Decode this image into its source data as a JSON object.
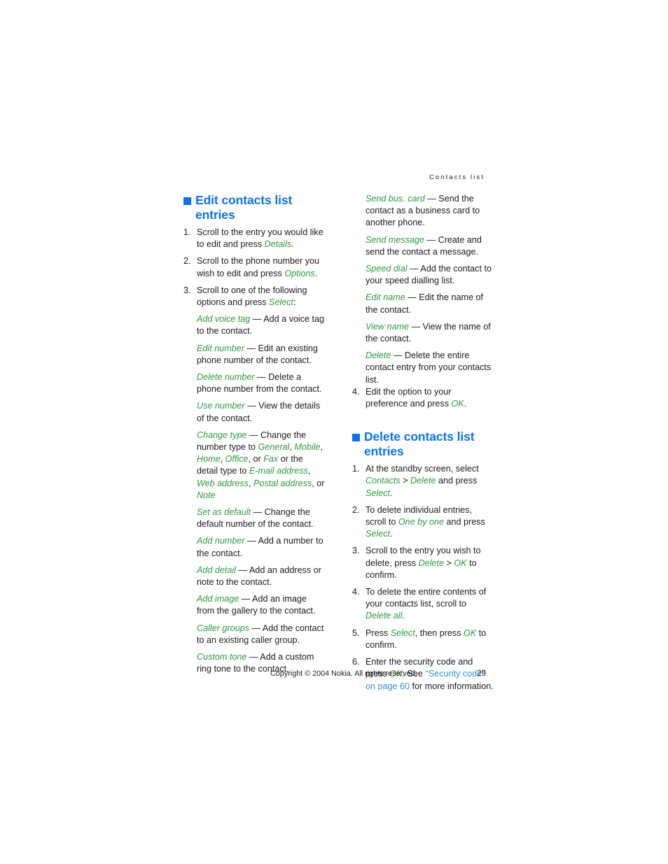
{
  "document": {
    "running_header": "Contacts list",
    "page_number": "29",
    "copyright": "Copyright © 2004 Nokia. All rights reserved.",
    "colors": {
      "heading_blue": "#0b72ec",
      "ui_green": "#2f9a3e",
      "link_blue": "#3b8fdd",
      "body_black": "#1a1a1a",
      "background": "#ffffff"
    }
  },
  "left_column": {
    "heading": "Edit contacts list entries",
    "steps": [
      {
        "number": "1.",
        "parts": [
          {
            "t": "Scroll to the entry you would like to edit and press ",
            "s": "body"
          },
          {
            "t": "Details",
            "s": "ui"
          },
          {
            "t": ".",
            "s": "body"
          }
        ]
      },
      {
        "number": "2.",
        "parts": [
          {
            "t": "Scroll to the phone number you wish to edit and press ",
            "s": "body"
          },
          {
            "t": "Options",
            "s": "ui"
          },
          {
            "t": ".",
            "s": "body"
          }
        ]
      },
      {
        "number": "3.",
        "parts": [
          {
            "t": "Scroll to one of the following options and press ",
            "s": "body"
          },
          {
            "t": "Select",
            "s": "ui"
          },
          {
            "t": ":",
            "s": "body"
          }
        ]
      }
    ],
    "options": [
      {
        "parts": [
          {
            "t": "Add voice tag",
            "s": "ui"
          },
          {
            "t": " — Add a voice tag to the contact.",
            "s": "body"
          }
        ]
      },
      {
        "parts": [
          {
            "t": "Edit number",
            "s": "ui"
          },
          {
            "t": " — Edit an existing phone number of the contact.",
            "s": "body"
          }
        ]
      },
      {
        "parts": [
          {
            "t": "Delete number",
            "s": "ui"
          },
          {
            "t": " — Delete a phone number from the contact.",
            "s": "body"
          }
        ]
      },
      {
        "parts": [
          {
            "t": "Use number",
            "s": "ui"
          },
          {
            "t": " — View the details of the contact.",
            "s": "body"
          }
        ]
      },
      {
        "parts": [
          {
            "t": "Change type",
            "s": "ui"
          },
          {
            "t": " — Change the number type to ",
            "s": "body"
          },
          {
            "t": "General",
            "s": "ui"
          },
          {
            "t": ", ",
            "s": "body"
          },
          {
            "t": "Mobile",
            "s": "ui"
          },
          {
            "t": ", ",
            "s": "body"
          },
          {
            "t": "Home",
            "s": "ui"
          },
          {
            "t": ", ",
            "s": "body"
          },
          {
            "t": "Office",
            "s": "ui"
          },
          {
            "t": ", or ",
            "s": "body"
          },
          {
            "t": "Fax",
            "s": "ui"
          },
          {
            "t": " or the detail type to ",
            "s": "body"
          },
          {
            "t": "E-mail address",
            "s": "ui"
          },
          {
            "t": ", ",
            "s": "body"
          },
          {
            "t": "Web address",
            "s": "ui"
          },
          {
            "t": ", ",
            "s": "body"
          },
          {
            "t": "Postal address",
            "s": "ui"
          },
          {
            "t": ", or ",
            "s": "body"
          },
          {
            "t": "Note",
            "s": "ui"
          }
        ]
      },
      {
        "parts": [
          {
            "t": "Set as default",
            "s": "ui"
          },
          {
            "t": " — Change the default number of the contact.",
            "s": "body"
          }
        ]
      },
      {
        "parts": [
          {
            "t": "Add number",
            "s": "ui"
          },
          {
            "t": " — Add a number to the contact.",
            "s": "body"
          }
        ]
      },
      {
        "parts": [
          {
            "t": "Add detail",
            "s": "ui"
          },
          {
            "t": " — Add an address or note to the contact.",
            "s": "body"
          }
        ]
      },
      {
        "parts": [
          {
            "t": "Add image",
            "s": "ui"
          },
          {
            "t": " — Add an image from the gallery to the contact.",
            "s": "body"
          }
        ]
      },
      {
        "parts": [
          {
            "t": "Caller groups",
            "s": "ui"
          },
          {
            "t": " — Add the contact to an existing caller group.",
            "s": "body"
          }
        ]
      },
      {
        "parts": [
          {
            "t": "Custom tone",
            "s": "ui"
          },
          {
            "t": " — Add a custom ring tone to the contact.",
            "s": "body"
          }
        ]
      }
    ]
  },
  "right_column": {
    "options": [
      {
        "parts": [
          {
            "t": "Send bus. card",
            "s": "ui"
          },
          {
            "t": " — Send the contact as a business card to another phone.",
            "s": "body"
          }
        ]
      },
      {
        "parts": [
          {
            "t": "Send message",
            "s": "ui"
          },
          {
            "t": " — Create and send the contact a message.",
            "s": "body"
          }
        ]
      },
      {
        "parts": [
          {
            "t": "Speed dial",
            "s": "ui"
          },
          {
            "t": " — Add the contact to your speed dialling list.",
            "s": "body"
          }
        ]
      },
      {
        "parts": [
          {
            "t": "Edit name",
            "s": "ui"
          },
          {
            "t": " — Edit the name of the contact.",
            "s": "body"
          }
        ]
      },
      {
        "parts": [
          {
            "t": "View name",
            "s": "ui"
          },
          {
            "t": " — View the name of the contact.",
            "s": "body"
          }
        ]
      },
      {
        "parts": [
          {
            "t": "Delete",
            "s": "ui"
          },
          {
            "t": " — Delete the entire contact entry from your contacts list.",
            "s": "body"
          }
        ]
      }
    ],
    "final_step": {
      "number": "4.",
      "parts": [
        {
          "t": "Edit the option to your preference and press ",
          "s": "body"
        },
        {
          "t": "OK",
          "s": "ui"
        },
        {
          "t": ".",
          "s": "body"
        }
      ]
    },
    "heading": "Delete contacts list entries",
    "steps": [
      {
        "number": "1.",
        "parts": [
          {
            "t": "At the standby screen, select ",
            "s": "body"
          },
          {
            "t": "Contacts",
            "s": "ui"
          },
          {
            "t": " > ",
            "s": "body"
          },
          {
            "t": "Delete",
            "s": "ui"
          },
          {
            "t": " and press ",
            "s": "body"
          },
          {
            "t": "Select",
            "s": "ui"
          },
          {
            "t": ".",
            "s": "body"
          }
        ]
      },
      {
        "number": "2.",
        "parts": [
          {
            "t": "To delete individual entries, scroll to ",
            "s": "body"
          },
          {
            "t": "One by one",
            "s": "ui"
          },
          {
            "t": " and press ",
            "s": "body"
          },
          {
            "t": "Select",
            "s": "ui"
          },
          {
            "t": ".",
            "s": "body"
          }
        ]
      },
      {
        "number": "3.",
        "parts": [
          {
            "t": "Scroll to the entry you wish to delete, press ",
            "s": "body"
          },
          {
            "t": "Delete",
            "s": "ui"
          },
          {
            "t": " > ",
            "s": "body"
          },
          {
            "t": "OK",
            "s": "ui"
          },
          {
            "t": " to confirm.",
            "s": "body"
          }
        ]
      },
      {
        "number": "4.",
        "parts": [
          {
            "t": "To delete the entire contents of your contacts list, scroll to ",
            "s": "body"
          },
          {
            "t": "Delete all",
            "s": "ui"
          },
          {
            "t": ".",
            "s": "body"
          }
        ]
      },
      {
        "number": "5.",
        "parts": [
          {
            "t": "Press ",
            "s": "body"
          },
          {
            "t": "Select",
            "s": "ui"
          },
          {
            "t": ", then press ",
            "s": "body"
          },
          {
            "t": "OK",
            "s": "ui"
          },
          {
            "t": " to confirm.",
            "s": "body"
          }
        ]
      },
      {
        "number": "6.",
        "parts": [
          {
            "t": "Enter the security code and press ",
            "s": "body"
          },
          {
            "t": "OK",
            "s": "ui"
          },
          {
            "t": ". See ",
            "s": "body"
          },
          {
            "t": "\"Security code\" on page 60",
            "s": "lnk"
          },
          {
            "t": " for more information.",
            "s": "body"
          }
        ]
      }
    ]
  }
}
